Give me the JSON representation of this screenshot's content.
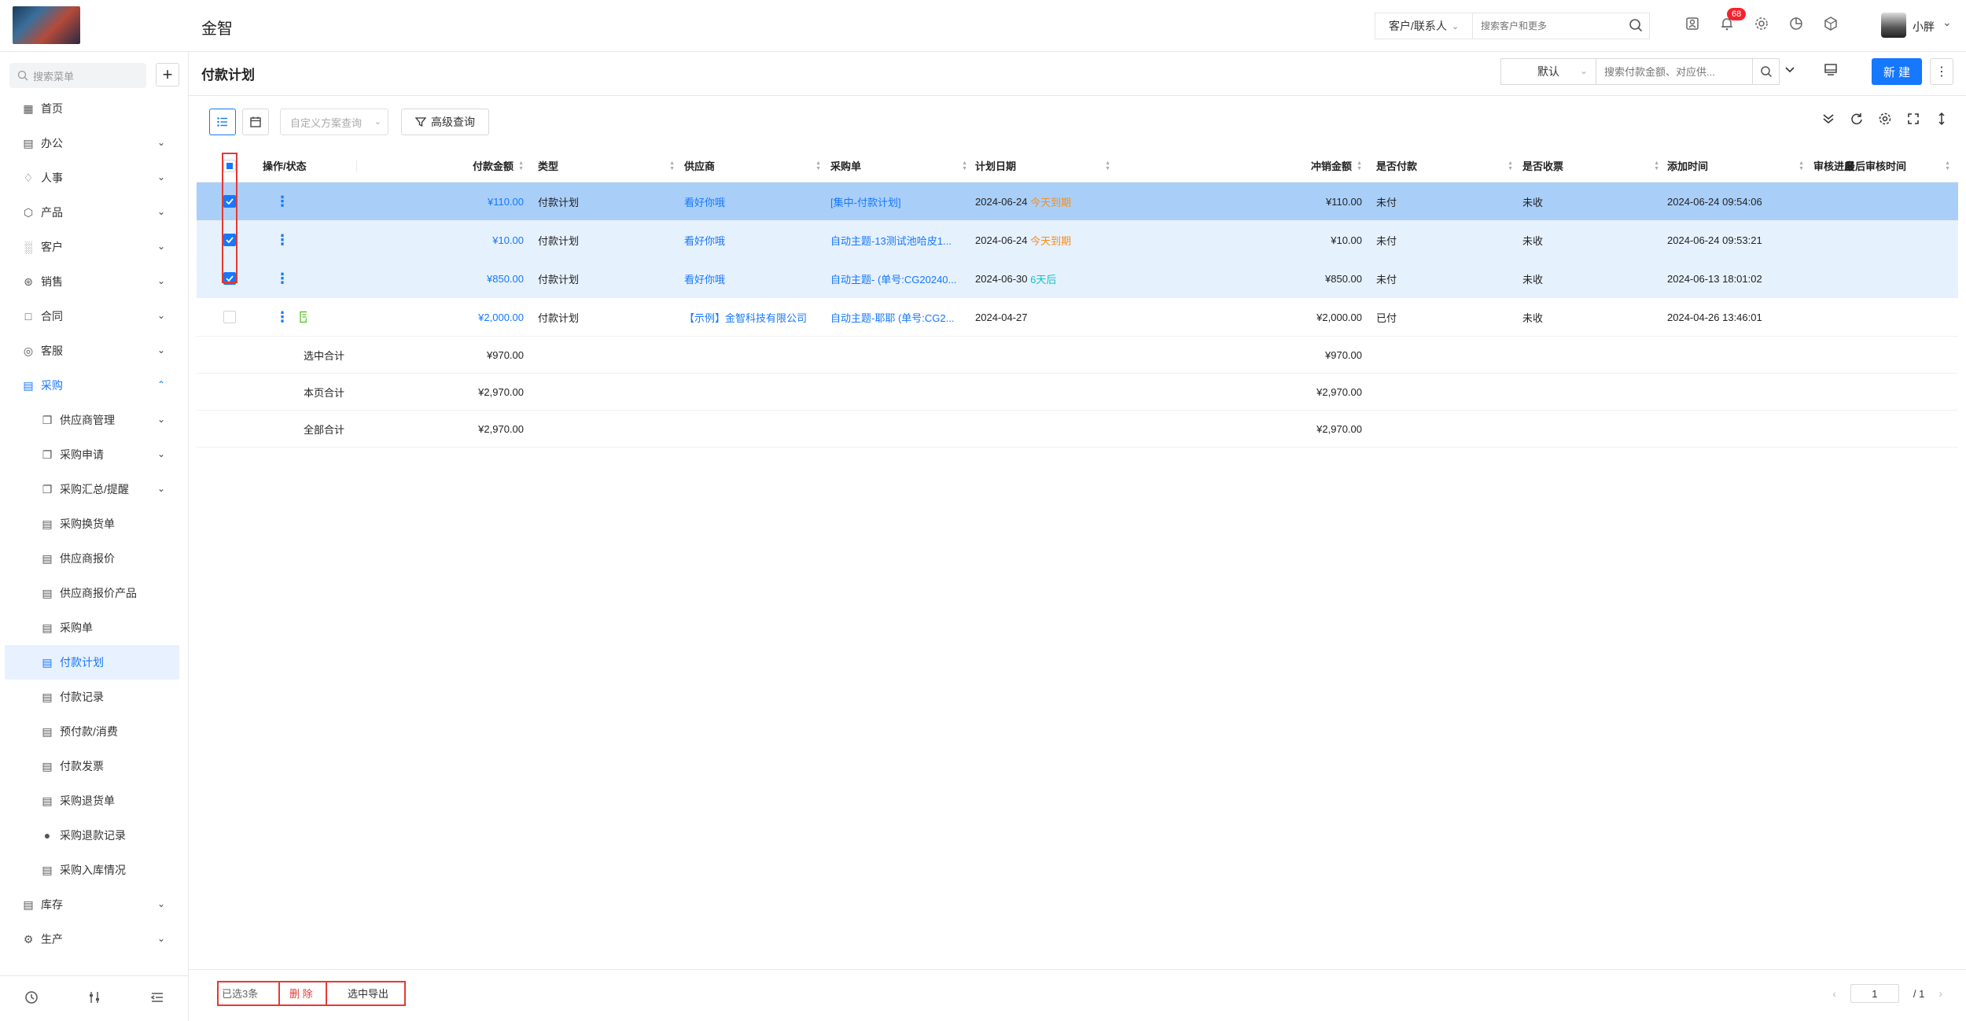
{
  "app": {
    "title": "金智"
  },
  "topbar": {
    "search_type": "客户/联系人",
    "search_placeholder": "搜索客户和更多",
    "notification_count": "68",
    "username": "小胖"
  },
  "sidebar": {
    "search_placeholder": "搜索菜单",
    "items": [
      {
        "label": "首页",
        "icon": "home-icon"
      },
      {
        "label": "办公",
        "icon": "office-icon",
        "chevron": "down"
      },
      {
        "label": "人事",
        "icon": "people-icon",
        "chevron": "down"
      },
      {
        "label": "产品",
        "icon": "product-icon",
        "chevron": "down"
      },
      {
        "label": "客户",
        "icon": "customer-icon",
        "chevron": "down"
      },
      {
        "label": "销售",
        "icon": "sales-icon",
        "chevron": "down"
      },
      {
        "label": "合同",
        "icon": "contract-icon",
        "chevron": "down"
      },
      {
        "label": "客服",
        "icon": "service-icon",
        "chevron": "down"
      },
      {
        "label": "采购",
        "icon": "purchase-icon",
        "chevron": "up"
      }
    ],
    "purchase_sub": [
      {
        "label": "供应商管理",
        "chevron": "down"
      },
      {
        "label": "采购申请",
        "chevron": "down"
      },
      {
        "label": "采购汇总/提醒",
        "chevron": "down"
      },
      {
        "label": "采购换货单"
      },
      {
        "label": "供应商报价"
      },
      {
        "label": "供应商报价产品"
      },
      {
        "label": "采购单"
      },
      {
        "label": "付款计划",
        "active": true
      },
      {
        "label": "付款记录"
      },
      {
        "label": "预付款/消费"
      },
      {
        "label": "付款发票"
      },
      {
        "label": "采购退货单"
      },
      {
        "label": "采购退款记录"
      },
      {
        "label": "采购入库情况"
      }
    ],
    "bottom_items": [
      {
        "label": "库存",
        "icon": "warehouse-icon"
      },
      {
        "label": "生产",
        "icon": "production-icon"
      }
    ]
  },
  "page": {
    "title": "付款计划",
    "view": "默认",
    "search_placeholder": "搜索付款金额、对应供...",
    "new_label": "新 建"
  },
  "toolbar": {
    "scheme_placeholder": "自定义方案查询",
    "advanced_label": "高级查询"
  },
  "table": {
    "headers": {
      "action": "操作/状态",
      "amount": "付款金额",
      "type": "类型",
      "supplier": "供应商",
      "po": "采购单",
      "date": "计划日期",
      "offset": "冲销金额",
      "paid": "是否付款",
      "invoiced": "是否收票",
      "added": "添加时间",
      "audit": "审核进度",
      "last_audit": "最后审核时间"
    },
    "rows": [
      {
        "amount": "¥110.00",
        "type": "付款计划",
        "supplier": "看好你哦",
        "po": "[集中-付款计划]",
        "date": "2024-06-24",
        "due": "今天到期",
        "due_color": "orange",
        "offset": "¥110.00",
        "paid": "未付",
        "invoiced": "未收",
        "added": "2024-06-24 09:54:06",
        "checked": true
      },
      {
        "amount": "¥10.00",
        "type": "付款计划",
        "supplier": "看好你哦",
        "po": "自动主题-13测试池哈皮1...",
        "date": "2024-06-24",
        "due": "今天到期",
        "due_color": "orange",
        "offset": "¥10.00",
        "paid": "未付",
        "invoiced": "未收",
        "added": "2024-06-24 09:53:21",
        "checked": true
      },
      {
        "amount": "¥850.00",
        "type": "付款计划",
        "supplier": "看好你哦",
        "po": "自动主题- (单号:CG20240...",
        "date": "2024-06-30",
        "due": "6天后",
        "due_color": "green",
        "offset": "¥850.00",
        "paid": "未付",
        "invoiced": "未收",
        "added": "2024-06-13 18:01:02",
        "checked": true
      },
      {
        "amount": "¥2,000.00",
        "type": "付款计划",
        "supplier": "【示例】金智科技有限公司",
        "po": "自动主题-耶耶 (单号:CG2...",
        "date": "2024-04-27",
        "due": "",
        "due_color": "",
        "offset": "¥2,000.00",
        "paid": "已付",
        "invoiced": "未收",
        "added": "2024-04-26 13:46:01",
        "checked": false
      }
    ],
    "summary": [
      {
        "label": "选中合计",
        "amount": "¥970.00",
        "offset": "¥970.00"
      },
      {
        "label": "本页合计",
        "amount": "¥2,970.00",
        "offset": "¥2,970.00"
      },
      {
        "label": "全部合计",
        "amount": "¥2,970.00",
        "offset": "¥2,970.00"
      }
    ]
  },
  "footer": {
    "selected": "已选3条",
    "delete": "删 除",
    "export": "选中导出",
    "page": "1",
    "total_pages": "/ 1"
  },
  "colors": {
    "accent": "#1677ff",
    "selected_row": "#a9cff9",
    "selected_row_light": "#e6f1fe",
    "danger": "#e53935",
    "due_today": "#fa8c16",
    "due_later": "#13c2c2"
  }
}
